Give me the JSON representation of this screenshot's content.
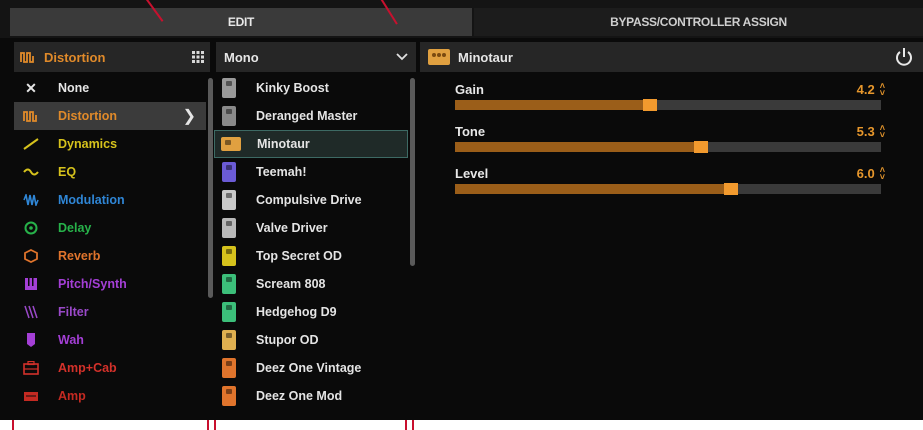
{
  "tabs": {
    "edit": "EDIT",
    "bypass": "BYPASS/CONTROLLER ASSIGN"
  },
  "category_header": {
    "label": "Distortion",
    "grid_icon": "grid-icon"
  },
  "model_header": {
    "label": "Mono",
    "dropdown_icon": "chevron-down-icon"
  },
  "detail_header": {
    "label": "Minotaur",
    "power_icon": "power-icon"
  },
  "categories": [
    {
      "label": "None",
      "icon": "close-icon",
      "color": "#e6e6e6"
    },
    {
      "label": "Distortion",
      "icon": "distortion-wave-icon",
      "color": "#e08a2a",
      "selected": true
    },
    {
      "label": "Dynamics",
      "icon": "dynamics-icon",
      "color": "#d6c21c"
    },
    {
      "label": "EQ",
      "icon": "eq-icon",
      "color": "#d6c21c"
    },
    {
      "label": "Modulation",
      "icon": "modulation-icon",
      "color": "#2f86d6"
    },
    {
      "label": "Delay",
      "icon": "delay-icon",
      "color": "#27b24a"
    },
    {
      "label": "Reverb",
      "icon": "reverb-icon",
      "color": "#e0742c"
    },
    {
      "label": "Pitch/Synth",
      "icon": "pitch-synth-icon",
      "color": "#a43fd6"
    },
    {
      "label": "Filter",
      "icon": "filter-icon",
      "color": "#9a49c9"
    },
    {
      "label": "Wah",
      "icon": "wah-icon",
      "color": "#a43fd6"
    },
    {
      "label": "Amp+Cab",
      "icon": "amp-cab-icon",
      "color": "#d3312a"
    },
    {
      "label": "Amp",
      "icon": "amp-icon",
      "color": "#c42a22"
    }
  ],
  "models": [
    {
      "label": "Kinky Boost",
      "icon": "pedal-icon",
      "color": "#9a9a9a"
    },
    {
      "label": "Deranged Master",
      "icon": "pedal-icon",
      "color": "#8a8a8a"
    },
    {
      "label": "Minotaur",
      "icon": "pedal-icon",
      "color": "#e0a040",
      "selected": true
    },
    {
      "label": "Teemah!",
      "icon": "pedal-icon",
      "color": "#6b5bd6"
    },
    {
      "label": "Compulsive Drive",
      "icon": "pedal-icon",
      "color": "#c9c9c9"
    },
    {
      "label": "Valve Driver",
      "icon": "pedal-icon",
      "color": "#b9b9b9"
    },
    {
      "label": "Top Secret OD",
      "icon": "pedal-icon",
      "color": "#d6c21c"
    },
    {
      "label": "Scream 808",
      "icon": "pedal-icon",
      "color": "#3cbf7a"
    },
    {
      "label": "Hedgehog D9",
      "icon": "pedal-icon",
      "color": "#3cbf7a"
    },
    {
      "label": "Stupor OD",
      "icon": "pedal-icon",
      "color": "#e0b050"
    },
    {
      "label": "Deez One Vintage",
      "icon": "pedal-icon",
      "color": "#e0742c"
    },
    {
      "label": "Deez One Mod",
      "icon": "pedal-icon",
      "color": "#e0742c"
    }
  ],
  "params": [
    {
      "label": "Gain",
      "value": "4.2",
      "fraction": 0.46
    },
    {
      "label": "Tone",
      "value": "5.3",
      "fraction": 0.58
    },
    {
      "label": "Level",
      "value": "6.0",
      "fraction": 0.65
    }
  ],
  "colors": {
    "accent": "#e7972c",
    "annotation": "#c8102e"
  }
}
